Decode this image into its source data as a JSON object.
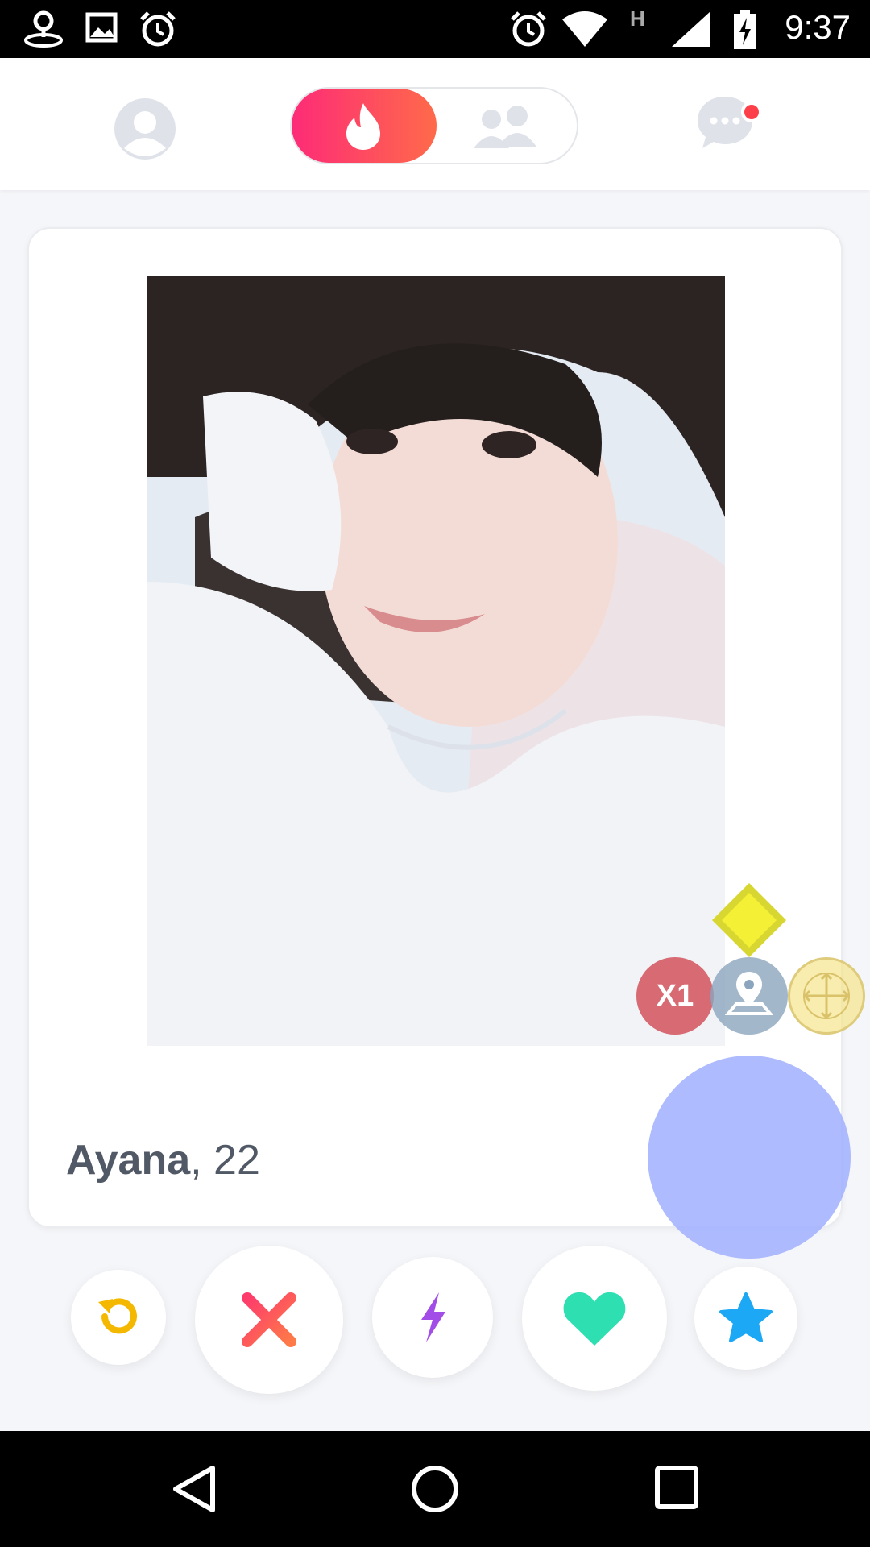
{
  "status_bar": {
    "time": "9:37",
    "left_icons": [
      "location-icon",
      "image-icon",
      "alarm-icon"
    ],
    "right_icons": [
      "alarm-icon",
      "wifi-icon",
      "network-h-icon",
      "signal-icon",
      "battery-charging-icon"
    ],
    "network_label": "H"
  },
  "header": {
    "modes": [
      "flame-icon",
      "group-icon"
    ],
    "active_mode": "flame-icon",
    "chat_has_notification": true
  },
  "card": {
    "name": "Ayana",
    "age_text": ", 22"
  },
  "overlay": {
    "multiplier_label": "X1"
  },
  "actions": [
    "rewind-icon",
    "nope-icon",
    "boost-icon",
    "like-icon",
    "super-like-icon"
  ],
  "colors": {
    "brand_gradient_start": "#fd2b77",
    "brand_gradient_end": "#ff6a4a",
    "rewind": "#f5b800",
    "nope": "#fd4f63",
    "boost": "#a34de8",
    "like": "#2ee0b1",
    "super_like": "#1ca8f4"
  },
  "nav_bar": [
    "back-icon",
    "home-icon",
    "recents-icon"
  ]
}
